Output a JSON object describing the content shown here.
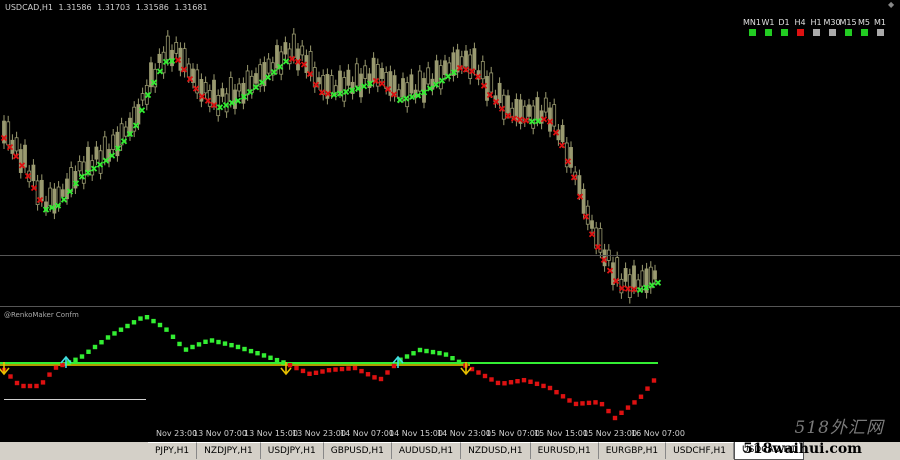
{
  "chart": {
    "symbol": "USDCAD,H1",
    "ohlc": [
      "1.31586",
      "1.31703",
      "1.31586",
      "1.31681"
    ]
  },
  "timeframes": [
    {
      "label": "MN1",
      "color": "#22cc22"
    },
    {
      "label": "W1",
      "color": "#22cc22"
    },
    {
      "label": "D1",
      "color": "#22cc22"
    },
    {
      "label": "H4",
      "color": "#dd1111"
    },
    {
      "label": "H1",
      "color": "#aaaaaa"
    },
    {
      "label": "M30",
      "color": "#aaaaaa"
    },
    {
      "label": "M15",
      "color": "#22cc22"
    },
    {
      "label": "M5",
      "color": "#22cc22"
    },
    {
      "label": "M1",
      "color": "#aaaaaa"
    }
  ],
  "indicator": {
    "name": "@RenkoMaker Confm"
  },
  "time_axis": [
    "Nov 23:00",
    "13 Nov 07:00",
    "13 Nov 15:00",
    "13 Nov 23:00",
    "14 Nov 07:00",
    "14 Nov 15:00",
    "14 Nov 23:00",
    "15 Nov 07:00",
    "15 Nov 15:00",
    "15 Nov 23:00",
    "16 Nov 07:00"
  ],
  "tabs": [
    {
      "label": "PJPY,H1",
      "active": false
    },
    {
      "label": "NZDJPY,H1",
      "active": false
    },
    {
      "label": "USDJPY,H1",
      "active": false
    },
    {
      "label": "GBPUSD,H1",
      "active": false
    },
    {
      "label": "AUDUSD,H1",
      "active": false
    },
    {
      "label": "NZDUSD,H1",
      "active": false
    },
    {
      "label": "EURUSD,H1",
      "active": false
    },
    {
      "label": "EURGBP,H1",
      "active": false
    },
    {
      "label": "USDCHF,H1",
      "active": false
    },
    {
      "label": "USDCAD,H1",
      "active": true
    }
  ],
  "watermark": {
    "text": "518外汇网",
    "url": "518waihui.com"
  },
  "colors": {
    "bull": "#33ee33",
    "bear": "#dd1111",
    "candle": "#9a9a70",
    "zero_line": "#e8d000"
  }
}
